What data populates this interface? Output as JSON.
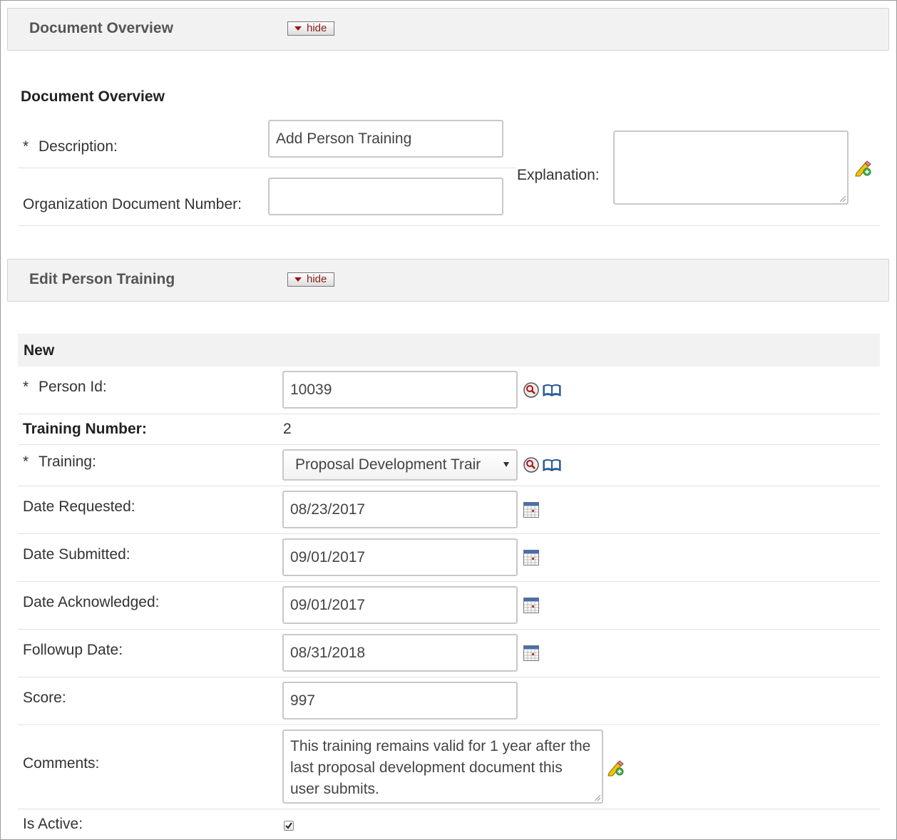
{
  "document_overview_tab": {
    "title": "Document Overview",
    "hide_label": "hide"
  },
  "document_overview": {
    "section_title": "Document Overview",
    "description_label": "Description:",
    "description_value": "Add Person Training",
    "org_doc_number_label": "Organization Document Number:",
    "org_doc_number_value": "",
    "explanation_label": "Explanation:",
    "explanation_value": "",
    "required_marker": "*"
  },
  "edit_tab": {
    "title": "Edit Person Training",
    "hide_label": "hide"
  },
  "edit_person_training": {
    "subheader": "New",
    "required_marker": "*",
    "person_id_label": "Person Id:",
    "person_id_value": "10039",
    "training_number_label": "Training Number:",
    "training_number_value": "2",
    "training_label": "Training:",
    "training_value": "Proposal Development Trair",
    "date_requested_label": "Date Requested:",
    "date_requested_value": "08/23/2017",
    "date_submitted_label": "Date Submitted:",
    "date_submitted_value": "09/01/2017",
    "date_acknowledged_label": "Date Acknowledged:",
    "date_acknowledged_value": "09/01/2017",
    "followup_date_label": "Followup Date:",
    "followup_date_value": "08/31/2018",
    "score_label": "Score:",
    "score_value": "997",
    "comments_label": "Comments:",
    "comments_value": "This training remains valid for 1 year after the last proposal development document this user submits.",
    "is_active_label": "Is Active:",
    "is_active_checked": true
  }
}
